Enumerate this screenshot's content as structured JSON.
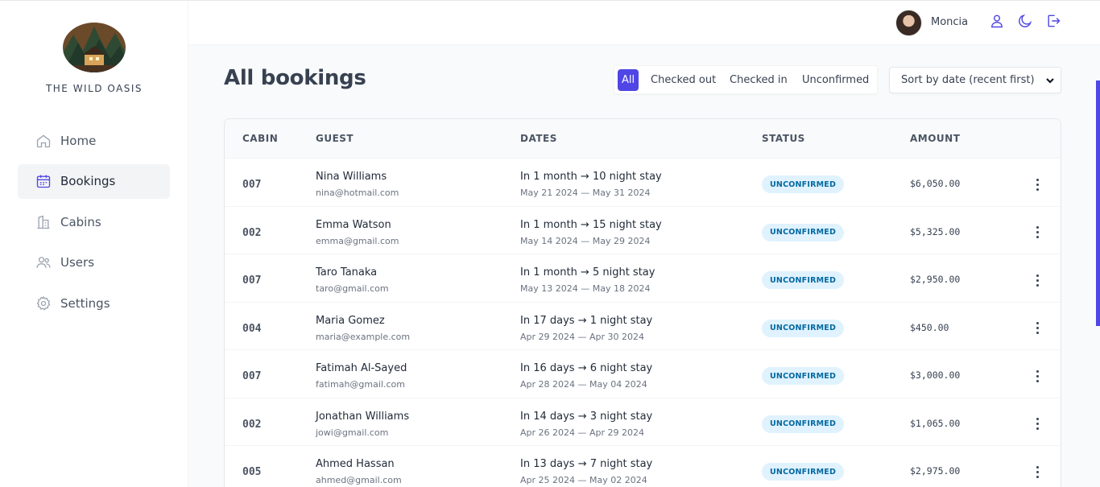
{
  "sidebar": {
    "brand": "THE WILD OASIS",
    "items": [
      {
        "label": "Home",
        "icon": "home-icon"
      },
      {
        "label": "Bookings",
        "icon": "calendar-icon",
        "active": true
      },
      {
        "label": "Cabins",
        "icon": "building-icon"
      },
      {
        "label": "Users",
        "icon": "users-icon"
      },
      {
        "label": "Settings",
        "icon": "gear-icon"
      }
    ]
  },
  "header": {
    "user_name": "Moncia",
    "icons": [
      "user-icon",
      "moon-icon",
      "logout-icon"
    ]
  },
  "main": {
    "title": "All bookings",
    "filter": {
      "options": [
        "All",
        "Checked out",
        "Checked in",
        "Unconfirmed"
      ],
      "active": "All"
    },
    "sort": {
      "selected": "Sort by date (recent first)"
    },
    "table": {
      "columns": [
        "CABIN",
        "GUEST",
        "DATES",
        "STATUS",
        "AMOUNT"
      ],
      "rows": [
        {
          "cabin": "007",
          "name": "Nina Williams",
          "email": "nina@hotmail.com",
          "when": "In 1 month → 10 night stay",
          "range": "May 21 2024 — May 31 2024",
          "status": "UNCONFIRMED",
          "amount": "$6,050.00"
        },
        {
          "cabin": "002",
          "name": "Emma Watson",
          "email": "emma@gmail.com",
          "when": "In 1 month → 15 night stay",
          "range": "May 14 2024 — May 29 2024",
          "status": "UNCONFIRMED",
          "amount": "$5,325.00"
        },
        {
          "cabin": "007",
          "name": "Taro Tanaka",
          "email": "taro@gmail.com",
          "when": "In 1 month → 5 night stay",
          "range": "May 13 2024 — May 18 2024",
          "status": "UNCONFIRMED",
          "amount": "$2,950.00"
        },
        {
          "cabin": "004",
          "name": "Maria Gomez",
          "email": "maria@example.com",
          "when": "In 17 days → 1 night stay",
          "range": "Apr 29 2024 — Apr 30 2024",
          "status": "UNCONFIRMED",
          "amount": "$450.00"
        },
        {
          "cabin": "007",
          "name": "Fatimah Al-Sayed",
          "email": "fatimah@gmail.com",
          "when": "In 16 days → 6 night stay",
          "range": "Apr 28 2024 — May 04 2024",
          "status": "UNCONFIRMED",
          "amount": "$3,000.00"
        },
        {
          "cabin": "002",
          "name": "Jonathan Williams",
          "email": "jowi@gmail.com",
          "when": "In 14 days → 3 night stay",
          "range": "Apr 26 2024 — Apr 29 2024",
          "status": "UNCONFIRMED",
          "amount": "$1,065.00"
        },
        {
          "cabin": "005",
          "name": "Ahmed Hassan",
          "email": "ahmed@gmail.com",
          "when": "In 13 days → 7 night stay",
          "range": "Apr 25 2024 — May 02 2024",
          "status": "UNCONFIRMED",
          "amount": "$2,975.00"
        }
      ]
    }
  },
  "colors": {
    "accent": "#4f46e5",
    "badge_bg": "#e0f2fe",
    "badge_text": "#0369a1"
  }
}
